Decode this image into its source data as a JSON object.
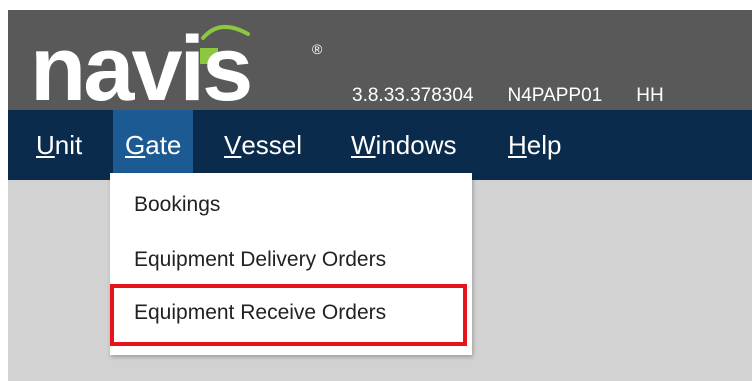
{
  "header": {
    "logo_text": "navis",
    "version": "3.8.33.378304",
    "server": "N4PAPP01",
    "extra": "HH"
  },
  "menubar": {
    "items": [
      {
        "label_underlined": "U",
        "label_rest": "nit"
      },
      {
        "label_underlined": "G",
        "label_rest": "ate"
      },
      {
        "label_underlined": "V",
        "label_rest": "essel"
      },
      {
        "label_underlined": "W",
        "label_rest": "indows"
      },
      {
        "label_underlined": "H",
        "label_rest": "elp"
      }
    ],
    "active": "Gate"
  },
  "dropdown": {
    "items": [
      {
        "label": "Bookings"
      },
      {
        "label": "Equipment Delivery Orders"
      },
      {
        "label": "Equipment Receive Orders"
      }
    ],
    "highlighted": "Equipment Receive Orders"
  },
  "colors": {
    "header_bg": "#595959",
    "menubar_bg": "#0b2b4c",
    "active_menu_bg": "#1c5a93",
    "logo_green": "#8dc63f",
    "highlight": "#e8141b"
  }
}
